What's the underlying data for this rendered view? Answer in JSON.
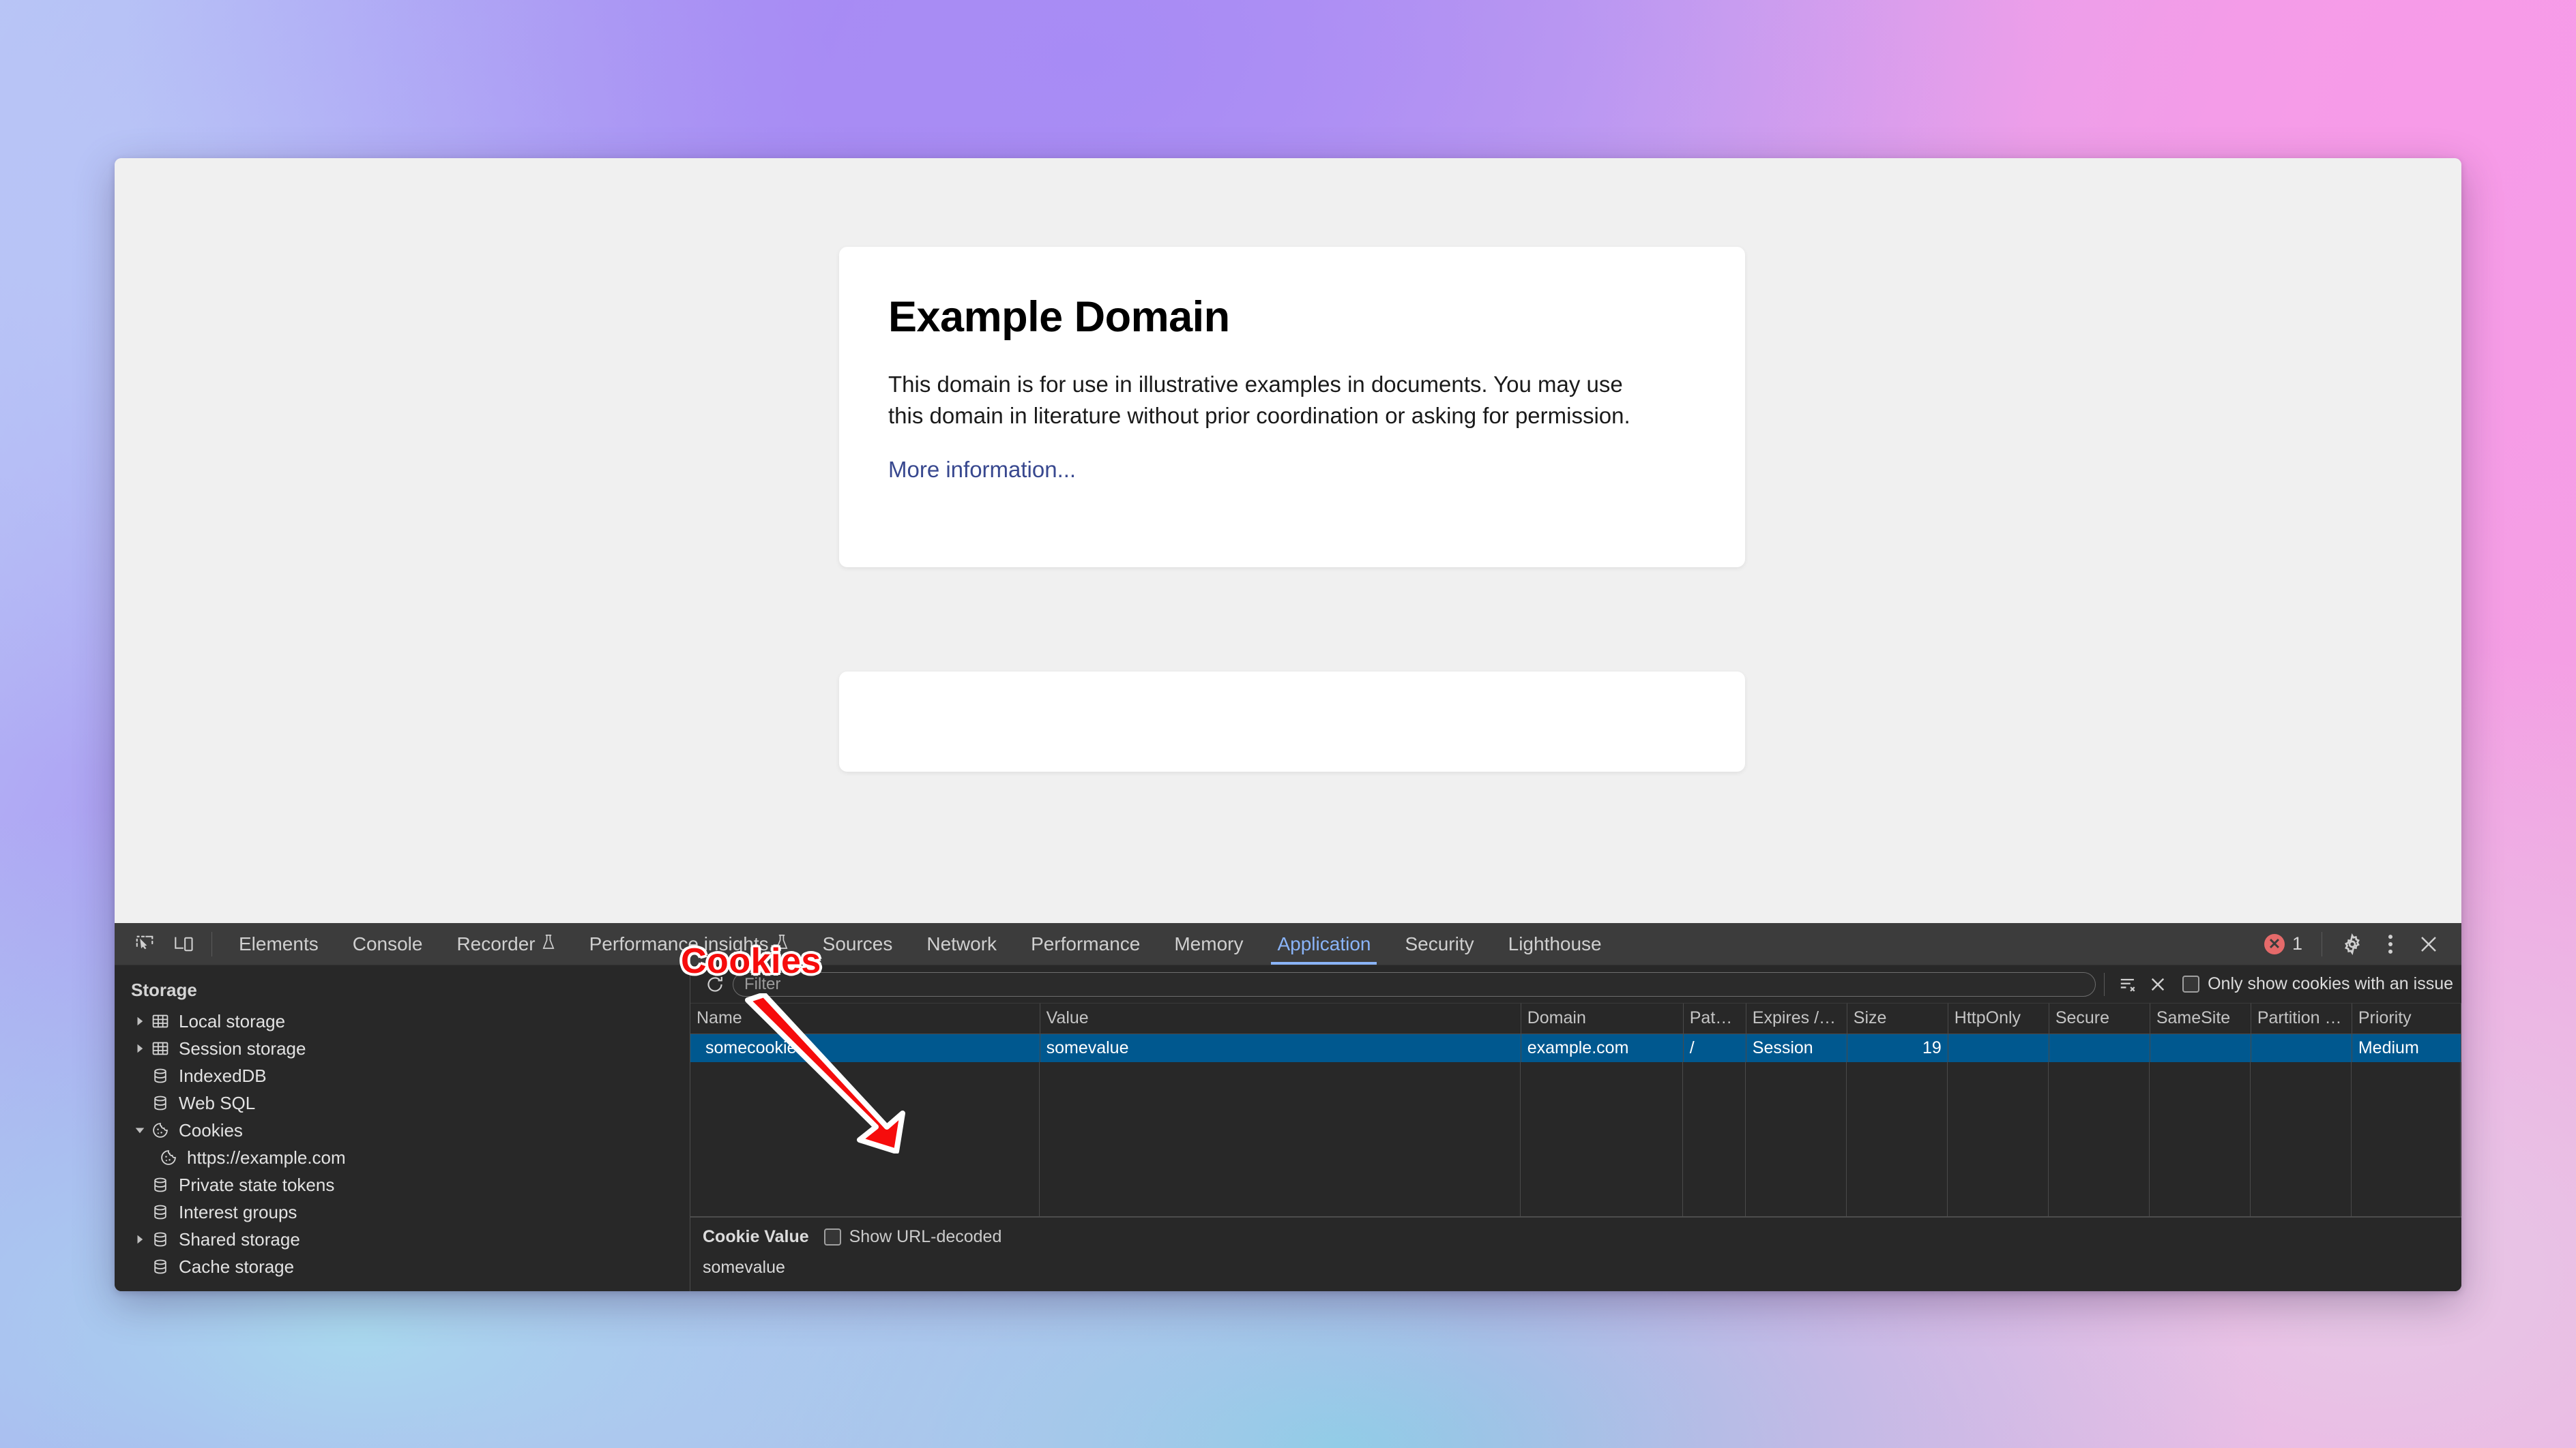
{
  "page": {
    "title": "Example Domain",
    "paragraph": "This domain is for use in illustrative examples in documents. You may use this domain in literature without prior coordination or asking for permission.",
    "link": "More information..."
  },
  "annotation": {
    "label": "Cookies",
    "color": "#f60c0c"
  },
  "devtools": {
    "toolbar_icons": [
      "inspect-element-icon",
      "device-toolbar-icon"
    ],
    "tabs": [
      {
        "label": "Elements",
        "active": false,
        "icon": null
      },
      {
        "label": "Console",
        "active": false,
        "icon": null
      },
      {
        "label": "Recorder",
        "active": false,
        "icon": "flask-icon"
      },
      {
        "label": "Performance insights",
        "active": false,
        "icon": "flask-icon"
      },
      {
        "label": "Sources",
        "active": false,
        "icon": null
      },
      {
        "label": "Network",
        "active": false,
        "icon": null
      },
      {
        "label": "Performance",
        "active": false,
        "icon": null
      },
      {
        "label": "Memory",
        "active": false,
        "icon": null
      },
      {
        "label": "Application",
        "active": true,
        "icon": null
      },
      {
        "label": "Security",
        "active": false,
        "icon": null
      },
      {
        "label": "Lighthouse",
        "active": false,
        "icon": null
      }
    ],
    "active_tab_color": "#8ab4f8",
    "error_count": "1",
    "right_icons": [
      "error-badge-icon",
      "settings-gear-icon",
      "more-options-icon",
      "close-devtools-icon"
    ]
  },
  "sidebar": {
    "header": "Storage",
    "items": [
      {
        "label": "Local storage",
        "icon": "table-icon",
        "twisty": "collapsed",
        "indent": 0
      },
      {
        "label": "Session storage",
        "icon": "table-icon",
        "twisty": "collapsed",
        "indent": 0
      },
      {
        "label": "IndexedDB",
        "icon": "database-icon",
        "twisty": "none",
        "indent": 0
      },
      {
        "label": "Web SQL",
        "icon": "database-icon",
        "twisty": "none",
        "indent": 0
      },
      {
        "label": "Cookies",
        "icon": "cookie-icon",
        "twisty": "expanded",
        "indent": 0
      },
      {
        "label": "https://example.com",
        "icon": "cookie-icon",
        "twisty": "none",
        "indent": 1
      },
      {
        "label": "Private state tokens",
        "icon": "database-icon",
        "twisty": "none",
        "indent": 0
      },
      {
        "label": "Interest groups",
        "icon": "database-icon",
        "twisty": "none",
        "indent": 0
      },
      {
        "label": "Shared storage",
        "icon": "database-icon",
        "twisty": "collapsed",
        "indent": 0
      },
      {
        "label": "Cache storage",
        "icon": "database-icon",
        "twisty": "none",
        "indent": 0
      }
    ]
  },
  "filter_bar": {
    "refresh_icon": "refresh-icon",
    "placeholder": "Filter",
    "value": "",
    "clear_filters_icon": "clear-filters-icon",
    "clear_icon": "clear-icon",
    "checkbox_label": "Only show cookies with an issue",
    "checkbox_checked": false
  },
  "cookie_table": {
    "columns": [
      {
        "label": "Name",
        "sorted": false
      },
      {
        "label": "Value",
        "sorted": false
      },
      {
        "label": "Domain",
        "sorted": false
      },
      {
        "label": "Path",
        "sorted": true,
        "sort_dir": "▲"
      },
      {
        "label": "Expires /…",
        "sorted": false
      },
      {
        "label": "Size",
        "sorted": false
      },
      {
        "label": "HttpOnly",
        "sorted": false
      },
      {
        "label": "Secure",
        "sorted": false
      },
      {
        "label": "SameSite",
        "sorted": false
      },
      {
        "label": "Partition …",
        "sorted": false
      },
      {
        "label": "Priority",
        "sorted": false
      }
    ],
    "rows": [
      {
        "selected": true,
        "cells": [
          "somecookie",
          "somevalue",
          "example.com",
          "/",
          "Session",
          "19",
          "",
          "",
          "",
          "",
          "Medium"
        ]
      }
    ],
    "selected_row_color": "#00588f"
  },
  "value_pane": {
    "title": "Cookie Value",
    "checkbox_label": "Show URL-decoded",
    "checkbox_checked": false,
    "value": "somevalue"
  }
}
